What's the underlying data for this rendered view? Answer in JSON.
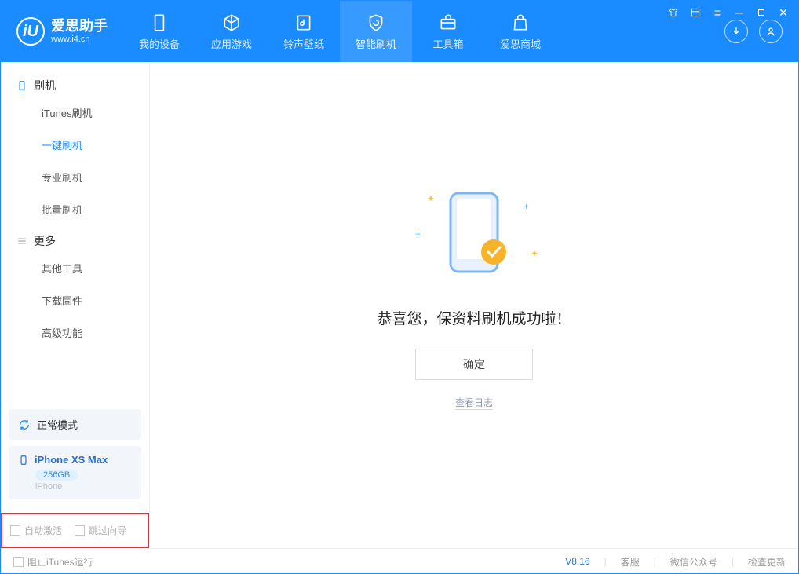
{
  "app": {
    "title": "爱思助手",
    "subtitle": "www.i4.cn",
    "logo_letter": "iU"
  },
  "nav": {
    "my_device": "我的设备",
    "apps_games": "应用游戏",
    "ring_wall": "铃声壁纸",
    "smart_flash": "智能刷机",
    "toolbox": "工具箱",
    "store": "爱思商城"
  },
  "sidebar": {
    "section_flash": "刷机",
    "items_flash": [
      "iTunes刷机",
      "一键刷机",
      "专业刷机",
      "批量刷机"
    ],
    "section_more": "更多",
    "items_more": [
      "其他工具",
      "下载固件",
      "高级功能"
    ]
  },
  "device": {
    "mode": "正常模式",
    "name": "iPhone XS Max",
    "capacity": "256GB",
    "type": "iPhone"
  },
  "options": {
    "auto_activate": "自动激活",
    "skip_wizard": "跳过向导"
  },
  "main": {
    "success_text": "恭喜您，保资料刷机成功啦！",
    "ok_button": "确定",
    "view_log": "查看日志"
  },
  "footer": {
    "block_itunes": "阻止iTunes运行",
    "version": "V8.16",
    "support": "客服",
    "wechat": "微信公众号",
    "check_update": "检查更新"
  }
}
